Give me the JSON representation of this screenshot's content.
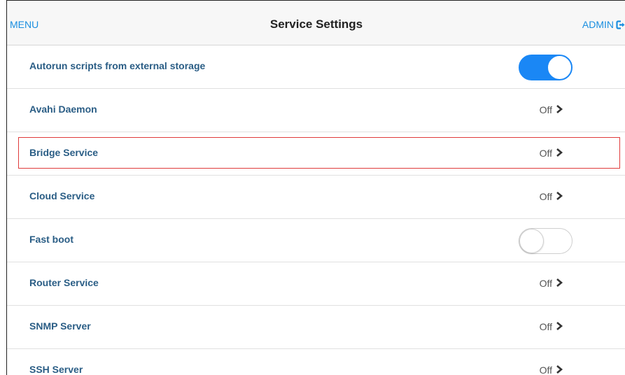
{
  "header": {
    "menu_label": "MENU",
    "title": "Service Settings",
    "admin_label": "ADMIN",
    "admin_icon": "logout-icon"
  },
  "colors": {
    "link": "#1a8ee0",
    "label": "#2a5d85",
    "toggle_on": "#1a87f5",
    "highlight": "#e03b3b"
  },
  "highlighted_row": "Bridge Service",
  "settings": [
    {
      "label": "Autorun scripts from external storage",
      "control": "toggle",
      "state": "on"
    },
    {
      "label": "Avahi Daemon",
      "control": "link",
      "value": "Off"
    },
    {
      "label": "Bridge Service",
      "control": "link",
      "value": "Off"
    },
    {
      "label": "Cloud Service",
      "control": "link",
      "value": "Off"
    },
    {
      "label": "Fast boot",
      "control": "toggle",
      "state": "off"
    },
    {
      "label": "Router Service",
      "control": "link",
      "value": "Off"
    },
    {
      "label": "SNMP Server",
      "control": "link",
      "value": "Off"
    },
    {
      "label": "SSH Server",
      "control": "link",
      "value": "Off"
    }
  ]
}
